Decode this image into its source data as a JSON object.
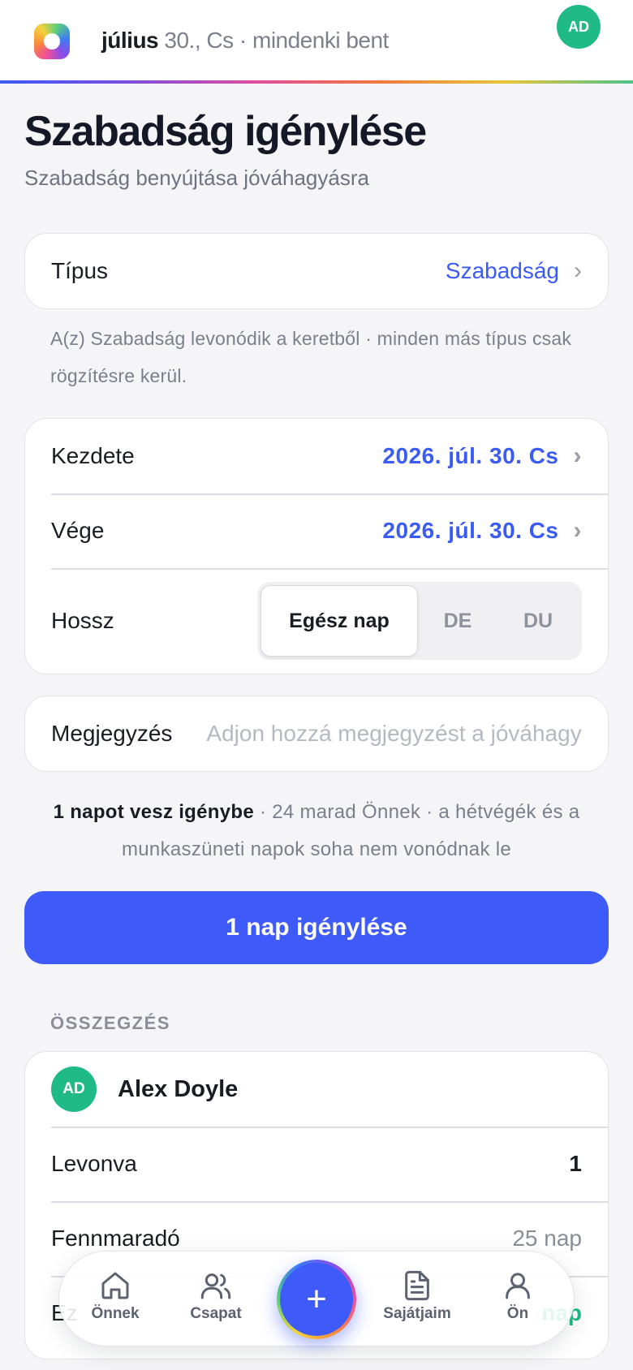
{
  "header": {
    "month": "július",
    "date_status": "30., Cs · mindenki bent",
    "avatar_initials": "AD"
  },
  "page": {
    "title": "Szabadság igénylése",
    "subtitle": "Szabadság benyújtása jóváhagyásra"
  },
  "type_row": {
    "label": "Típus",
    "value": "Szabadság"
  },
  "type_hint": "A(z) Szabadság levonódik a keretből · minden más típus csak rögzítésre kerül.",
  "dates": {
    "start_label": "Kezdete",
    "start_value": "2026. júl. 30. Cs",
    "end_label": "Vége",
    "end_value": "2026. júl. 30. Cs",
    "length_label": "Hossz",
    "length_options": [
      "Egész nap",
      "DE",
      "DU"
    ],
    "length_selected": "Egész nap"
  },
  "note": {
    "label": "Megjegyzés",
    "placeholder": "Adjon hozzá megjegyzést a jóváhagyónak"
  },
  "info": {
    "strong": "1 napot vesz igénybe",
    "rest": " · 24 marad Önnek · a hétvégék és a munkaszüneti napok soha nem vonódnak le"
  },
  "submit_label": "1 nap igénylése",
  "summary": {
    "section_label": "ÖSSZEGZÉS",
    "avatar_initials": "AD",
    "name": "Alex Doyle",
    "deducted_label": "Levonva",
    "deducted_value": "1",
    "remaining_label": "Fennmaradó",
    "remaining_value": "25 nap",
    "third_label": "Ez",
    "third_value": "nap"
  },
  "nav": {
    "home": "Önnek",
    "team": "Csapat",
    "add": "+",
    "mine": "Sajátjaim",
    "you": "Ön"
  },
  "colors": {
    "accent": "#3e5bfa",
    "green": "#1fba86",
    "muted": "#7a7f8b"
  }
}
